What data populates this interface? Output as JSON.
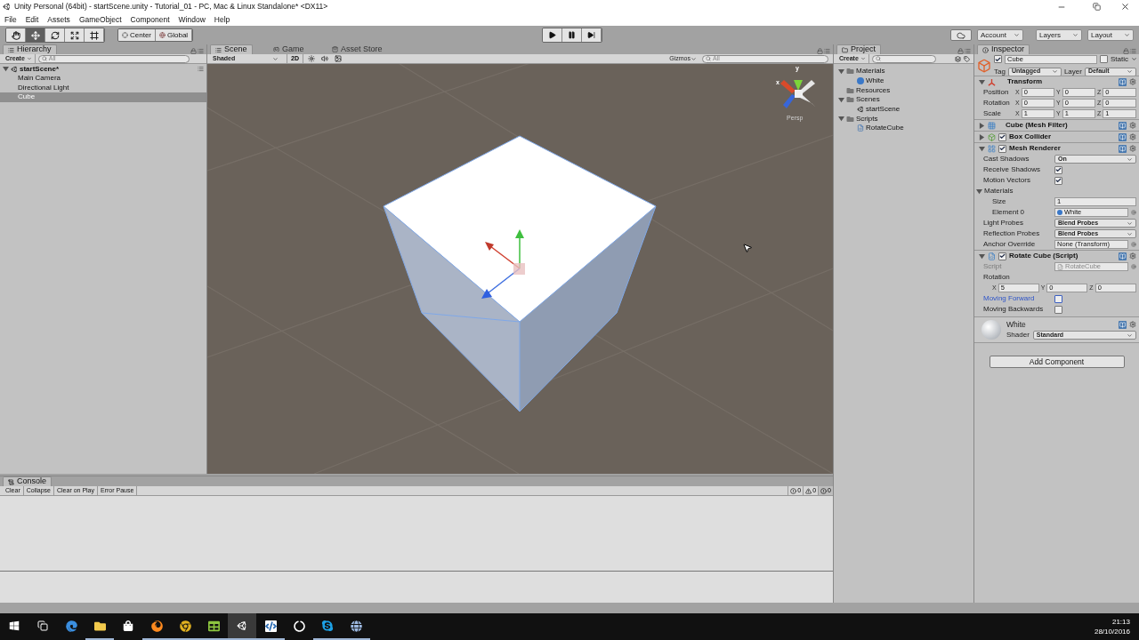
{
  "window": {
    "title": "Unity Personal (64bit) - startScene.unity - Tutorial_01 - PC, Mac & Linux Standalone* <DX11>"
  },
  "menu": [
    "File",
    "Edit",
    "Assets",
    "GameObject",
    "Component",
    "Window",
    "Help"
  ],
  "toolbar": {
    "tools": [
      {
        "kind": "hand",
        "selected": false
      },
      {
        "kind": "move",
        "selected": true
      },
      {
        "kind": "rotate",
        "selected": false
      },
      {
        "kind": "scale",
        "selected": false
      },
      {
        "kind": "rect",
        "selected": false
      }
    ],
    "pivot": [
      {
        "kind": "pivot",
        "label": "Center"
      },
      {
        "kind": "globe",
        "label": "Global"
      }
    ],
    "play": [
      {
        "kind": "play"
      },
      {
        "kind": "pause"
      },
      {
        "kind": "step"
      }
    ],
    "menus": [
      "Account",
      "Layers",
      "Layout"
    ]
  },
  "hierarchy": {
    "tab": "Hierarchy",
    "create": "Create",
    "search_placeholder": "All",
    "scene": "startScene*",
    "items": [
      {
        "label": "Main Camera",
        "selected": false
      },
      {
        "label": "Directional Light",
        "selected": false
      },
      {
        "label": "Cube",
        "selected": true
      }
    ]
  },
  "scene": {
    "tabs": [
      {
        "label": "Scene",
        "kind": "scene",
        "selected": true
      },
      {
        "label": "Game",
        "kind": "game",
        "selected": false
      },
      {
        "label": "Asset Store",
        "kind": "store",
        "selected": false
      }
    ],
    "shading": "Shaded",
    "mode_2d": "2D",
    "gizmos": "Gizmos",
    "search_placeholder": "All",
    "axis_labels": [
      "y",
      "x"
    ],
    "projection": "Persp"
  },
  "project": {
    "tab": "Project",
    "create": "Create",
    "tree": [
      {
        "label": "Materials",
        "kind": "folder",
        "expanded": true,
        "children": [
          {
            "label": "White",
            "kind": "material"
          }
        ]
      },
      {
        "label": "Resources",
        "kind": "folder"
      },
      {
        "label": "Scenes",
        "kind": "folder",
        "expanded": true,
        "children": [
          {
            "label": "startScene",
            "kind": "scene"
          }
        ]
      },
      {
        "label": "Scripts",
        "kind": "folder",
        "expanded": true,
        "children": [
          {
            "label": "RotateCube",
            "kind": "script"
          }
        ]
      }
    ]
  },
  "inspector": {
    "tab": "Inspector",
    "object": {
      "active": true,
      "name": "Cube",
      "static_label": "Static",
      "static": false,
      "tag_label": "Tag",
      "tag": "Untagged",
      "layer_label": "Layer",
      "layer": "Default"
    },
    "components": [
      {
        "kind": "transform",
        "title": "Transform",
        "expanded": true,
        "rows": [
          {
            "label": "Position",
            "axes": [
              {
                "label": "X",
                "value": "0"
              },
              {
                "label": "Y",
                "value": "0"
              },
              {
                "label": "Z",
                "value": "0"
              }
            ]
          },
          {
            "label": "Rotation",
            "axes": [
              {
                "label": "X",
                "value": "0"
              },
              {
                "label": "Y",
                "value": "0"
              },
              {
                "label": "Z",
                "value": "0"
              }
            ]
          },
          {
            "label": "Scale",
            "axes": [
              {
                "label": "X",
                "value": "1"
              },
              {
                "label": "Y",
                "value": "1"
              },
              {
                "label": "Z",
                "value": "1"
              }
            ]
          }
        ]
      },
      {
        "kind": "mesh-filter",
        "title": "Cube (Mesh Filter)",
        "expanded": false
      },
      {
        "kind": "collider",
        "title": "Box Collider",
        "expanded": false,
        "enabled": true
      },
      {
        "kind": "renderer",
        "title": "Mesh Renderer",
        "expanded": true,
        "enabled": true,
        "fields": [
          {
            "kind": "dropdown",
            "label": "Cast Shadows",
            "value": "On"
          },
          {
            "kind": "checkbox",
            "label": "Receive Shadows",
            "checked": true
          },
          {
            "kind": "checkbox",
            "label": "Motion Vectors",
            "checked": true
          },
          {
            "kind": "group",
            "label": "Materials",
            "expanded": true,
            "children": [
              {
                "kind": "text",
                "label": "Size",
                "value": "1"
              },
              {
                "kind": "material-ref",
                "label": "Element 0",
                "value": "White"
              }
            ]
          },
          {
            "kind": "dropdown",
            "label": "Light Probes",
            "value": "Blend Probes"
          },
          {
            "kind": "dropdown",
            "label": "Reflection Probes",
            "value": "Blend Probes"
          },
          {
            "kind": "object",
            "label": "Anchor Override",
            "value": "None (Transform)"
          }
        ]
      },
      {
        "kind": "script",
        "title": "Rotate Cube (Script)",
        "expanded": true,
        "enabled": true,
        "fields": [
          {
            "kind": "script-ref",
            "label": "Script",
            "value": "RotateCube",
            "disabled": true
          },
          {
            "kind": "vector",
            "label": "Rotation",
            "axes": [
              {
                "label": "X",
                "value": "5"
              },
              {
                "label": "Y",
                "value": "0"
              },
              {
                "label": "Z",
                "value": "0"
              }
            ]
          },
          {
            "kind": "checkbox",
            "label": "Moving Forward",
            "checked": false,
            "focused": true
          },
          {
            "kind": "checkbox",
            "label": "Moving Backwards",
            "checked": false
          }
        ]
      }
    ],
    "material": {
      "name": "White",
      "shader_label": "Shader",
      "shader": "Standard"
    },
    "add_button": "Add Component"
  },
  "console": {
    "tab": "Console",
    "buttons": [
      "Clear",
      "Collapse",
      "Clear on Play",
      "Error Pause"
    ],
    "counts": [
      {
        "kind": "info",
        "count": "0"
      },
      {
        "kind": "warning",
        "count": "0"
      },
      {
        "kind": "error",
        "count": "0"
      }
    ]
  },
  "taskbar": {
    "apps": [
      {
        "kind": "start",
        "running": false,
        "active": false
      },
      {
        "kind": "taskview",
        "running": false,
        "active": false
      },
      {
        "kind": "edge",
        "running": false,
        "active": false
      },
      {
        "kind": "explorer",
        "running": true,
        "active": false
      },
      {
        "kind": "store",
        "running": false,
        "active": false
      },
      {
        "kind": "firefox",
        "running": true,
        "active": false
      },
      {
        "kind": "chrome",
        "running": true,
        "active": false
      },
      {
        "kind": "sheet",
        "running": true,
        "active": false
      },
      {
        "kind": "unity",
        "running": true,
        "active": true
      },
      {
        "kind": "code",
        "running": true,
        "active": false
      },
      {
        "kind": "recorder",
        "running": false,
        "active": false
      },
      {
        "kind": "skype",
        "running": true,
        "active": false
      },
      {
        "kind": "globe",
        "running": true,
        "active": false
      }
    ],
    "time": "21:13",
    "date": "28/10/2016"
  }
}
